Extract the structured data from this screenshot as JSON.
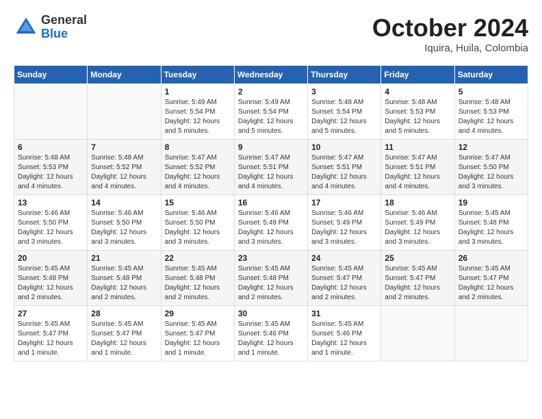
{
  "logo": {
    "general": "General",
    "blue": "Blue"
  },
  "header": {
    "month": "October 2024",
    "location": "Iquira, Huila, Colombia"
  },
  "weekdays": [
    "Sunday",
    "Monday",
    "Tuesday",
    "Wednesday",
    "Thursday",
    "Friday",
    "Saturday"
  ],
  "weeks": [
    [
      {
        "day": "",
        "info": ""
      },
      {
        "day": "",
        "info": ""
      },
      {
        "day": "1",
        "info": "Sunrise: 5:49 AM\nSunset: 5:54 PM\nDaylight: 12 hours\nand 5 minutes."
      },
      {
        "day": "2",
        "info": "Sunrise: 5:49 AM\nSunset: 5:54 PM\nDaylight: 12 hours\nand 5 minutes."
      },
      {
        "day": "3",
        "info": "Sunrise: 5:48 AM\nSunset: 5:54 PM\nDaylight: 12 hours\nand 5 minutes."
      },
      {
        "day": "4",
        "info": "Sunrise: 5:48 AM\nSunset: 5:53 PM\nDaylight: 12 hours\nand 5 minutes."
      },
      {
        "day": "5",
        "info": "Sunrise: 5:48 AM\nSunset: 5:53 PM\nDaylight: 12 hours\nand 4 minutes."
      }
    ],
    [
      {
        "day": "6",
        "info": "Sunrise: 5:48 AM\nSunset: 5:53 PM\nDaylight: 12 hours\nand 4 minutes."
      },
      {
        "day": "7",
        "info": "Sunrise: 5:48 AM\nSunset: 5:52 PM\nDaylight: 12 hours\nand 4 minutes."
      },
      {
        "day": "8",
        "info": "Sunrise: 5:47 AM\nSunset: 5:52 PM\nDaylight: 12 hours\nand 4 minutes."
      },
      {
        "day": "9",
        "info": "Sunrise: 5:47 AM\nSunset: 5:51 PM\nDaylight: 12 hours\nand 4 minutes."
      },
      {
        "day": "10",
        "info": "Sunrise: 5:47 AM\nSunset: 5:51 PM\nDaylight: 12 hours\nand 4 minutes."
      },
      {
        "day": "11",
        "info": "Sunrise: 5:47 AM\nSunset: 5:51 PM\nDaylight: 12 hours\nand 4 minutes."
      },
      {
        "day": "12",
        "info": "Sunrise: 5:47 AM\nSunset: 5:50 PM\nDaylight: 12 hours\nand 3 minutes."
      }
    ],
    [
      {
        "day": "13",
        "info": "Sunrise: 5:46 AM\nSunset: 5:50 PM\nDaylight: 12 hours\nand 3 minutes."
      },
      {
        "day": "14",
        "info": "Sunrise: 5:46 AM\nSunset: 5:50 PM\nDaylight: 12 hours\nand 3 minutes."
      },
      {
        "day": "15",
        "info": "Sunrise: 5:46 AM\nSunset: 5:50 PM\nDaylight: 12 hours\nand 3 minutes."
      },
      {
        "day": "16",
        "info": "Sunrise: 5:46 AM\nSunset: 5:49 PM\nDaylight: 12 hours\nand 3 minutes."
      },
      {
        "day": "17",
        "info": "Sunrise: 5:46 AM\nSunset: 5:49 PM\nDaylight: 12 hours\nand 3 minutes."
      },
      {
        "day": "18",
        "info": "Sunrise: 5:46 AM\nSunset: 5:49 PM\nDaylight: 12 hours\nand 3 minutes."
      },
      {
        "day": "19",
        "info": "Sunrise: 5:45 AM\nSunset: 5:48 PM\nDaylight: 12 hours\nand 3 minutes."
      }
    ],
    [
      {
        "day": "20",
        "info": "Sunrise: 5:45 AM\nSunset: 5:48 PM\nDaylight: 12 hours\nand 2 minutes."
      },
      {
        "day": "21",
        "info": "Sunrise: 5:45 AM\nSunset: 5:48 PM\nDaylight: 12 hours\nand 2 minutes."
      },
      {
        "day": "22",
        "info": "Sunrise: 5:45 AM\nSunset: 5:48 PM\nDaylight: 12 hours\nand 2 minutes."
      },
      {
        "day": "23",
        "info": "Sunrise: 5:45 AM\nSunset: 5:48 PM\nDaylight: 12 hours\nand 2 minutes."
      },
      {
        "day": "24",
        "info": "Sunrise: 5:45 AM\nSunset: 5:47 PM\nDaylight: 12 hours\nand 2 minutes."
      },
      {
        "day": "25",
        "info": "Sunrise: 5:45 AM\nSunset: 5:47 PM\nDaylight: 12 hours\nand 2 minutes."
      },
      {
        "day": "26",
        "info": "Sunrise: 5:45 AM\nSunset: 5:47 PM\nDaylight: 12 hours\nand 2 minutes."
      }
    ],
    [
      {
        "day": "27",
        "info": "Sunrise: 5:45 AM\nSunset: 5:47 PM\nDaylight: 12 hours\nand 1 minute."
      },
      {
        "day": "28",
        "info": "Sunrise: 5:45 AM\nSunset: 5:47 PM\nDaylight: 12 hours\nand 1 minute."
      },
      {
        "day": "29",
        "info": "Sunrise: 5:45 AM\nSunset: 5:47 PM\nDaylight: 12 hours\nand 1 minute."
      },
      {
        "day": "30",
        "info": "Sunrise: 5:45 AM\nSunset: 5:46 PM\nDaylight: 12 hours\nand 1 minute."
      },
      {
        "day": "31",
        "info": "Sunrise: 5:45 AM\nSunset: 5:46 PM\nDaylight: 12 hours\nand 1 minute."
      },
      {
        "day": "",
        "info": ""
      },
      {
        "day": "",
        "info": ""
      }
    ]
  ]
}
